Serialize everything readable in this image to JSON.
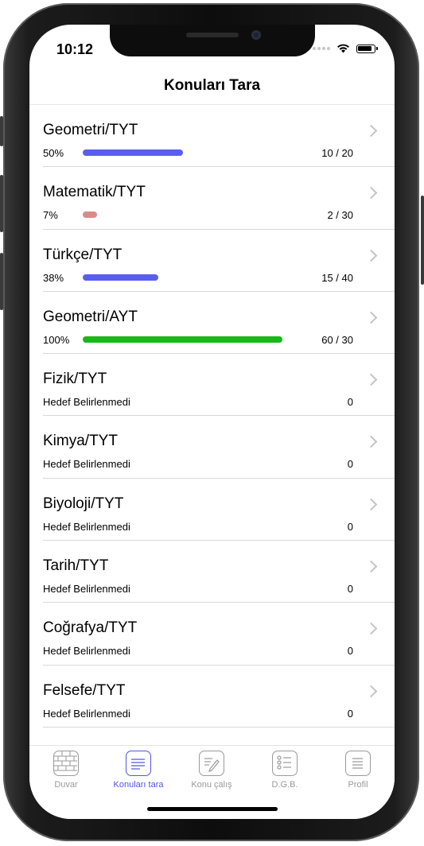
{
  "status": {
    "time": "10:12"
  },
  "nav": {
    "title": "Konuları Tara"
  },
  "rows": [
    {
      "subject": "Geometri/TYT",
      "percent_label": "50%",
      "progress": 0.5,
      "ratio": "10 / 20",
      "color": "#5a5ef0"
    },
    {
      "subject": "Matematik/TYT",
      "percent_label": "7%",
      "progress": 0.07,
      "ratio": "2 / 30",
      "color": "#d98a8a"
    },
    {
      "subject": "Türkçe/TYT",
      "percent_label": "38%",
      "progress": 0.38,
      "ratio": "15 / 40",
      "color": "#5a5ef0"
    },
    {
      "subject": "Geometri/AYT",
      "percent_label": "100%",
      "progress": 1.0,
      "ratio": "60 / 30",
      "color": "#17b817"
    },
    {
      "subject": "Fizik/TYT",
      "hedef": "Hedef Belirlenmedi",
      "count": "0"
    },
    {
      "subject": "Kimya/TYT",
      "hedef": "Hedef Belirlenmedi",
      "count": "0"
    },
    {
      "subject": "Biyoloji/TYT",
      "hedef": "Hedef Belirlenmedi",
      "count": "0"
    },
    {
      "subject": "Tarih/TYT",
      "hedef": "Hedef Belirlenmedi",
      "count": "0"
    },
    {
      "subject": "Coğrafya/TYT",
      "hedef": "Hedef Belirlenmedi",
      "count": "0"
    },
    {
      "subject": "Felsefe/TYT",
      "hedef": "Hedef Belirlenmedi",
      "count": "0"
    }
  ],
  "tabs": [
    {
      "label": "Duvar",
      "icon": "brick-wall-icon",
      "active": false
    },
    {
      "label": "Konuları tara",
      "icon": "list-lines-icon",
      "active": true
    },
    {
      "label": "Konu çalış",
      "icon": "pencil-note-icon",
      "active": false
    },
    {
      "label": "D.G.B.",
      "icon": "checklist-icon",
      "active": false
    },
    {
      "label": "Profil",
      "icon": "document-icon",
      "active": false
    }
  ],
  "colors": {
    "accent": "#5353e6",
    "progress_blue": "#5a5ef0",
    "progress_red": "#d98a8a",
    "progress_green": "#17b817"
  }
}
